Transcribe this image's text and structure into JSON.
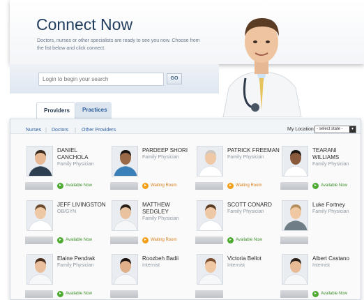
{
  "header": {
    "title": "Connect Now",
    "subtitle": "Doctors, nurses or other specialists are ready to see you now. Choose from the list below and click connect."
  },
  "search": {
    "placeholder": "Login to begin your search",
    "go_label": "GO"
  },
  "tabs": [
    {
      "label": "Providers",
      "active": true
    },
    {
      "label": "Practices",
      "active": false
    }
  ],
  "filters": {
    "links": [
      "Nurses",
      "Doctors",
      "Other Providers"
    ],
    "location_label": "My Location:",
    "location_value": "- select state -"
  },
  "colors": {
    "available": "#4caa2f",
    "waiting": "#f2a019",
    "link": "#2d5e9e",
    "title": "#1f3b5c"
  },
  "providers": [
    {
      "name": "DANIEL CANCHOLA",
      "role": "Family Physician",
      "status": "Available Now",
      "status_type": "available"
    },
    {
      "name": "PARDEEP SHORI",
      "role": "Family Physician",
      "status": "Waiting Room",
      "status_type": "waiting"
    },
    {
      "name": "PATRICK FREEMAN",
      "role": "Family Physician",
      "status": "Waiting Room",
      "status_type": "waiting"
    },
    {
      "name": "TEARANI WILLIAMS",
      "role": "Family Physician",
      "status": "Available Now",
      "status_type": "available"
    },
    {
      "name": "JEFF LIVINGSTON",
      "role": "OB/GYN",
      "status": "Available Now",
      "status_type": "available"
    },
    {
      "name": "MATTHEW SEDGLEY",
      "role": "Family Physician",
      "status": "Waiting Room",
      "status_type": "waiting"
    },
    {
      "name": "SCOTT CONARD",
      "role": "Family Physician",
      "status": "Available Now",
      "status_type": "available"
    },
    {
      "name": "Luke Fortney",
      "role": "Family Physician",
      "status": "",
      "status_type": "none"
    },
    {
      "name": "Elaine Pendrak",
      "role": "Family Physician",
      "status": "Available Now",
      "status_type": "available"
    },
    {
      "name": "Roozbeh Badii",
      "role": "Internist",
      "status": "",
      "status_type": "none"
    },
    {
      "name": "Victoria Bellot",
      "role": "Internist",
      "status": "",
      "status_type": "none"
    },
    {
      "name": "Albert Castano",
      "role": "Internist",
      "status": "Available Now",
      "status_type": "available"
    }
  ]
}
